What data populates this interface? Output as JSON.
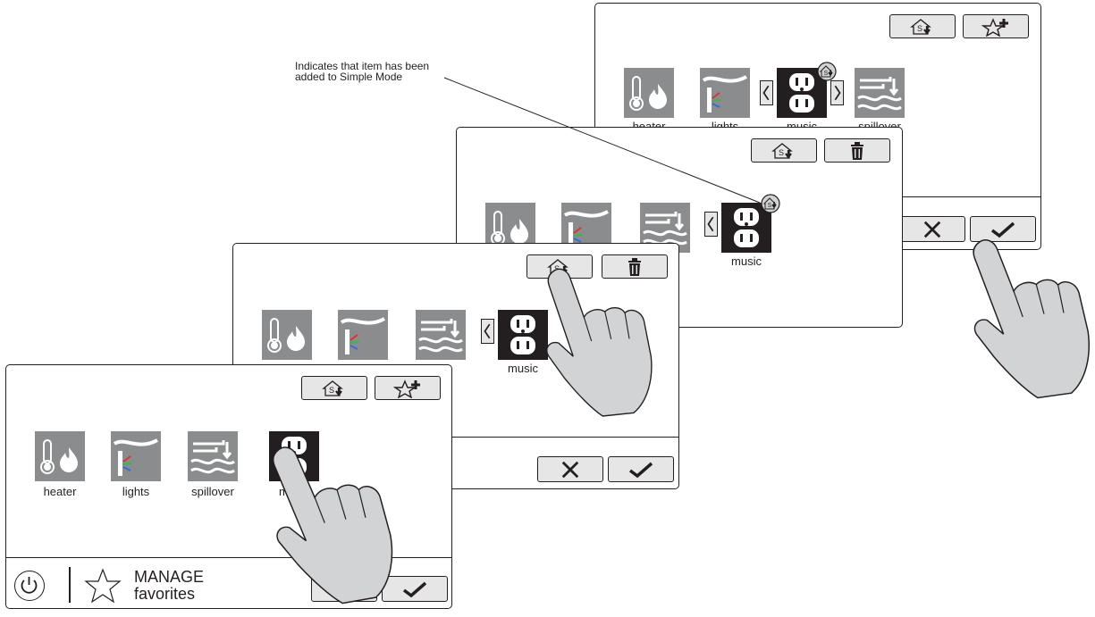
{
  "annotation": {
    "line1": "Indicates that item has been",
    "line2": "added to Simple Mode"
  },
  "labels": {
    "heater": "heater",
    "lights": "lights",
    "spillover": "spillover",
    "music": "music"
  },
  "footer": {
    "title_line1": "MANAGE",
    "title_line2": "favorites"
  },
  "icons": {
    "simple_mode": "simple-mode-icon",
    "add_favorite": "star-plus-icon",
    "delete": "trash-icon",
    "cancel": "x-icon",
    "confirm": "check-icon",
    "power": "power-icon",
    "favorites": "star-outline-icon"
  },
  "colors": {
    "tile_gray": "#8a8c8e",
    "tile_black": "#231f20",
    "button_fill": "#e6e6e6",
    "hand_fill": "#d1d3d4"
  }
}
